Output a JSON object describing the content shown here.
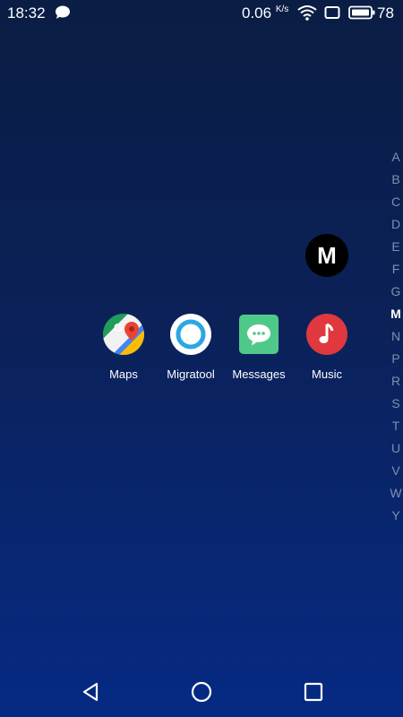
{
  "status": {
    "time": "18:32",
    "speed": "0.06",
    "speed_unit": "K/s",
    "battery": "78",
    "icons": [
      "chat-bubble-icon",
      "wifi-icon",
      "screen-icon",
      "battery-icon"
    ]
  },
  "search_letter": "M",
  "apps": [
    {
      "label": "Maps",
      "icon": "google-maps-icon"
    },
    {
      "label": "Migratool",
      "icon": "migratool-icon"
    },
    {
      "label": "Messages",
      "icon": "messages-icon"
    },
    {
      "label": "Music",
      "icon": "music-icon"
    }
  ],
  "alphabet": [
    "A",
    "B",
    "C",
    "D",
    "E",
    "F",
    "G",
    "M",
    "N",
    "P",
    "R",
    "S",
    "T",
    "U",
    "V",
    "W",
    "Y"
  ],
  "alphabet_active": "M",
  "nav": {
    "icons": [
      "back-icon",
      "home-icon",
      "recents-icon"
    ]
  },
  "colors": {
    "background_top": "#0a1d44",
    "background_bottom": "#062a84",
    "music_red": "#e0383e",
    "messages_green": "#4fc98a",
    "migratool_blue": "#2ba7e3"
  }
}
